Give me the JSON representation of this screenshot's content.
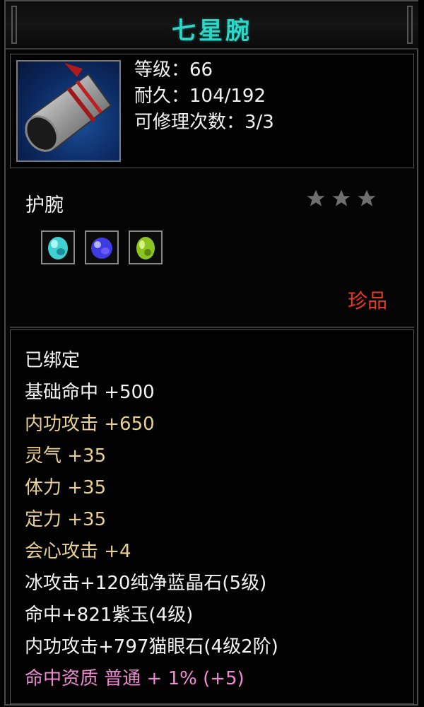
{
  "title": "七星腕",
  "stats": {
    "level": "等级：66",
    "durability": "耐久：104/192",
    "repair_count": "可修理次数：3/3"
  },
  "item_type": "护腕",
  "star_count": 3,
  "gems": [
    {
      "icon": "cyan-gem-icon",
      "color": "#3fd0d0"
    },
    {
      "icon": "purple-gem-icon",
      "color": "#5a5aff"
    },
    {
      "icon": "green-gem-icon",
      "color": "#9ccc2a"
    }
  ],
  "rarity": "珍品",
  "attributes": {
    "bound": "已绑定",
    "base_hit": "基础命中 +500",
    "inner_attack": "内功攻击 +650",
    "spirit": "灵气 +35",
    "stamina": "体力 +35",
    "composure": "定力 +35",
    "crit_attack": "会心攻击 +4",
    "gem1": "冰攻击+120纯净蓝晶石(5级)",
    "gem2": "命中+821紫玉(4级)",
    "gem3": "内功攻击+797猫眼石(4级2阶)",
    "aptitude": "命中资质 普通 + 1% (+5)"
  },
  "colors": {
    "title": "#2fd6c8",
    "rarity": "#e53a22",
    "gold_attr": "#e8cf92",
    "pink_attr": "#ef8ad3"
  }
}
